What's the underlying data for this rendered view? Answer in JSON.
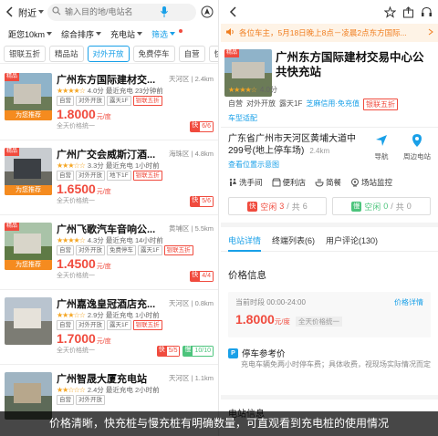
{
  "left": {
    "header": {
      "location": "附近",
      "search_placeholder": "输入目的地/电站名"
    },
    "filters": [
      {
        "label": "距您10km",
        "active": false
      },
      {
        "label": "综合排序",
        "active": false
      },
      {
        "label": "充电站",
        "active": false
      },
      {
        "label": "筛选",
        "active": true
      }
    ],
    "tags": [
      {
        "label": "银联五折",
        "on": false
      },
      {
        "label": "精品站",
        "on": false
      },
      {
        "label": "对外开放",
        "on": true
      },
      {
        "label": "免费停车",
        "on": false
      },
      {
        "label": "自营",
        "on": false
      },
      {
        "label": "快",
        "on": false
      }
    ],
    "stations": [
      {
        "name": "广州东方国际建材交...",
        "district": "天河区",
        "distance": "2.4km",
        "stars": "★★★★☆",
        "rating_text": "4.0分 最近充电 23分钟前",
        "chips": [
          "自营",
          "对外开放",
          "露天1F",
          "银联五折"
        ],
        "price": "1.8000",
        "unit": "元/度",
        "sub": "全天价格统一",
        "fast_label": "快",
        "fast": "6/6",
        "slow_label": "",
        "slow": "",
        "recommended": "为您推荐",
        "hot": "精品",
        "colors": {
          "sky": "#8fb3c9",
          "ground": "#6b7b57",
          "bld": "#c9c4b8"
        }
      },
      {
        "name": "广州广交会威斯汀酒...",
        "district": "海珠区",
        "distance": "4.8km",
        "stars": "★★★☆☆",
        "rating_text": "3.3分 最近充电 1小时前",
        "chips": [
          "自营",
          "对外开放",
          "地下1F",
          "银联五折"
        ],
        "price": "1.6500",
        "unit": "元/度",
        "sub": "全天价格统一",
        "fast_label": "快",
        "fast": "5/6",
        "slow_label": "",
        "slow": "",
        "recommended": "为您推荐",
        "hot": "精品",
        "colors": {
          "sky": "#c8ccd0",
          "ground": "#6a6a62",
          "bld": "#3b3f44"
        }
      },
      {
        "name": "广州飞歌汽车音响公...",
        "district": "黄埔区",
        "distance": "5.5km",
        "stars": "★★★★☆",
        "rating_text": "4.3分 最近充电 14小时前",
        "chips": [
          "自营",
          "对外开放",
          "免费停车",
          "露天1F",
          "银联五折"
        ],
        "price": "1.4500",
        "unit": "元/度",
        "sub": "全天价格统一",
        "fast_label": "快",
        "fast": "4/4",
        "slow_label": "",
        "slow": "",
        "recommended": "为您推荐",
        "hot": "精品",
        "colors": {
          "sky": "#a9c3a8",
          "ground": "#5e7a45",
          "bld": "#d8d5c9"
        }
      },
      {
        "name": "广州嘉逸皇冠酒店充...",
        "district": "天河区",
        "distance": "0.8km",
        "stars": "★★★☆☆",
        "rating_text": "2.9分 最近充电 1小时前",
        "chips": [
          "自营",
          "对外开放",
          "露天1F",
          "银联五折"
        ],
        "price": "1.7000",
        "unit": "元/度",
        "sub": "全天价格统一",
        "fast_label": "快",
        "fast": "5/5",
        "slow_label": "慢",
        "slow": "10/10",
        "recommended": "",
        "hot": "",
        "colors": {
          "sky": "#b9c4cf",
          "ground": "#7c7c74",
          "bld": "#e6e2da"
        }
      },
      {
        "name": "广州智晟大厦充电站",
        "district": "天河区",
        "distance": "1.1km",
        "stars": "★★☆☆☆",
        "rating_text": "2.4分 最近充电 2小时前",
        "chips": [
          "自营",
          "对外开放"
        ],
        "price": "",
        "unit": "",
        "sub": "",
        "fast_label": "",
        "fast": "",
        "slow_label": "",
        "slow": "",
        "recommended": "",
        "hot": "",
        "colors": {
          "sky": "#9fb4c2",
          "ground": "#5d6a58",
          "bld": "#b7a78c"
        }
      }
    ]
  },
  "right": {
    "notice": "各位车主，5月18日晚上8点－凌晨2点东方国际...",
    "title": "广州东方国际建材交易中心公共快充站",
    "hot": "精品",
    "stars": "★★★★☆",
    "rating": "4.0分",
    "chips": [
      {
        "text": "自营",
        "style": "plain"
      },
      {
        "text": "对外开放",
        "style": "plain"
      },
      {
        "text": "露天1F",
        "style": "plain"
      },
      {
        "text": "芝麻信用·免充值",
        "style": "blue"
      },
      {
        "text": "银联五折",
        "style": "red"
      }
    ],
    "car_link": "车型适配",
    "address": "广东省广州市天河区黄埔大道中299号(地上停车场)",
    "address_dist": "2.4km",
    "photos_link": "查看位置示意图",
    "nav_label": "导航",
    "monitor_label": "周边电站",
    "facilities": [
      "洗手间",
      "便利店",
      "简餐",
      "场站监控"
    ],
    "fast_status": {
      "badge": "快",
      "label": "空闲",
      "free": "3",
      "total": "6"
    },
    "slow_status": {
      "badge": "慢",
      "label": "空闲",
      "free": "0",
      "total": "0"
    },
    "tabs": [
      "电站详情",
      "终端列表(6)",
      "用户评论(130)"
    ],
    "price_title": "价格信息",
    "price_time": "当前时段 00:00-24:00",
    "price_link": "价格详情",
    "price": "1.8000",
    "price_unit": "元/度",
    "price_note": "全天价格统一",
    "parking_badge": "P",
    "parking_title": "停车参考价",
    "parking_desc": "充电车辆免两小时停车费；具体收费，视现场实际情况而定",
    "elec_title": "电站信息"
  },
  "caption": "价格清晰，快充桩与慢充桩有明确数量，可直观看到充电桩的使用情况",
  "colors": {
    "accent": "#19a0e8",
    "price": "#f04b3e",
    "notice": "#f07d1e",
    "free_fast": "#f04b3e",
    "free_slow": "#4cc47c"
  }
}
